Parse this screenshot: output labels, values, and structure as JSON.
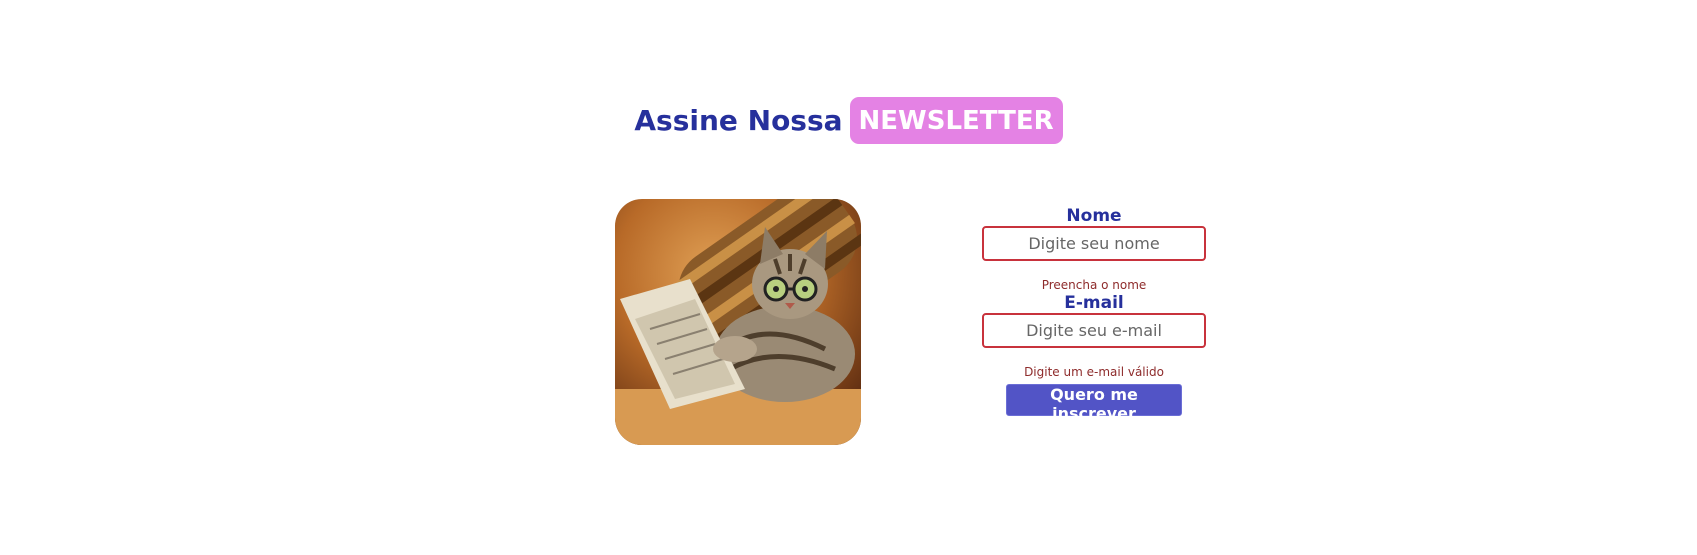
{
  "header": {
    "title": "Assine Nossa",
    "badge": "NEWSLETTER"
  },
  "image": {
    "icon": "newsletter-cat-image"
  },
  "form": {
    "name": {
      "label": "Nome",
      "placeholder": "Digite seu nome",
      "value": "",
      "error": "Preencha o nome"
    },
    "email": {
      "label": "E-mail",
      "placeholder": "Digite seu e-mail",
      "value": "",
      "error": "Digite um e-mail válido"
    },
    "submit_label": "Quero me inscrever"
  },
  "colors": {
    "title": "#26309c",
    "badge_bg": "#e482e4",
    "input_border": "#c8323c",
    "error_text": "#8e2b2b",
    "button_bg": "#5254c6"
  }
}
